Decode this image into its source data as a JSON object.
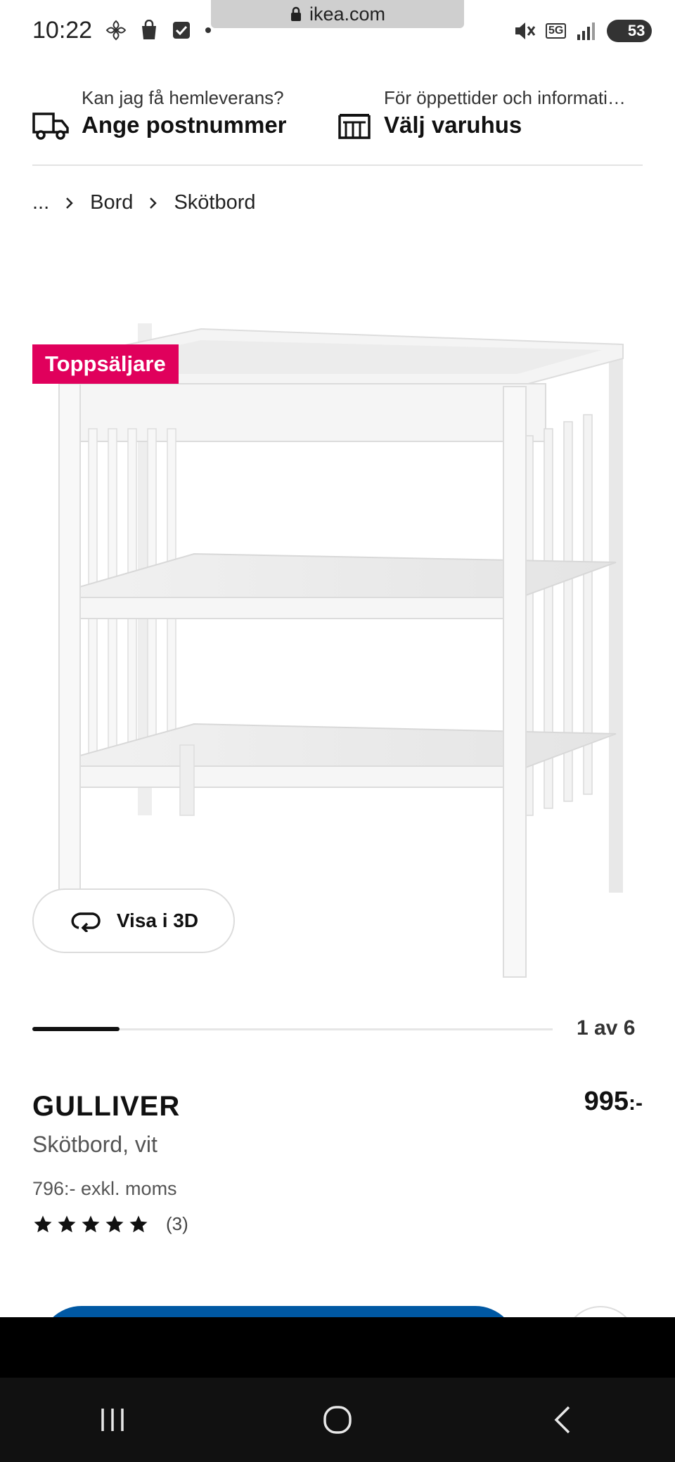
{
  "status_bar": {
    "time": "10:22",
    "url": "ikea.com",
    "network": "5G",
    "battery": "53"
  },
  "header": {
    "delivery": {
      "question": "Kan jag få hemleverans?",
      "action": "Ange postnummer",
      "icon": "truck-icon"
    },
    "store": {
      "question": "För öppettider och informati…",
      "action": "Välj varuhus",
      "icon": "store-icon"
    }
  },
  "breadcrumb": {
    "items": [
      "...",
      "Bord",
      "Skötbord"
    ]
  },
  "product_image": {
    "badge": "Toppsäljare",
    "view3d_label": "Visa i 3D",
    "pager": "1 av 6",
    "pager_progress": 0.17
  },
  "product": {
    "name": "GULLIVER",
    "description": "Skötbord, vit",
    "price": "995",
    "price_suffix": ":-",
    "price_ex_vat": "796:- exkl. moms",
    "rating_stars": 5,
    "review_count": "(3)"
  },
  "colors": {
    "badge": "#e0005c",
    "primary_button": "#0058a3"
  }
}
